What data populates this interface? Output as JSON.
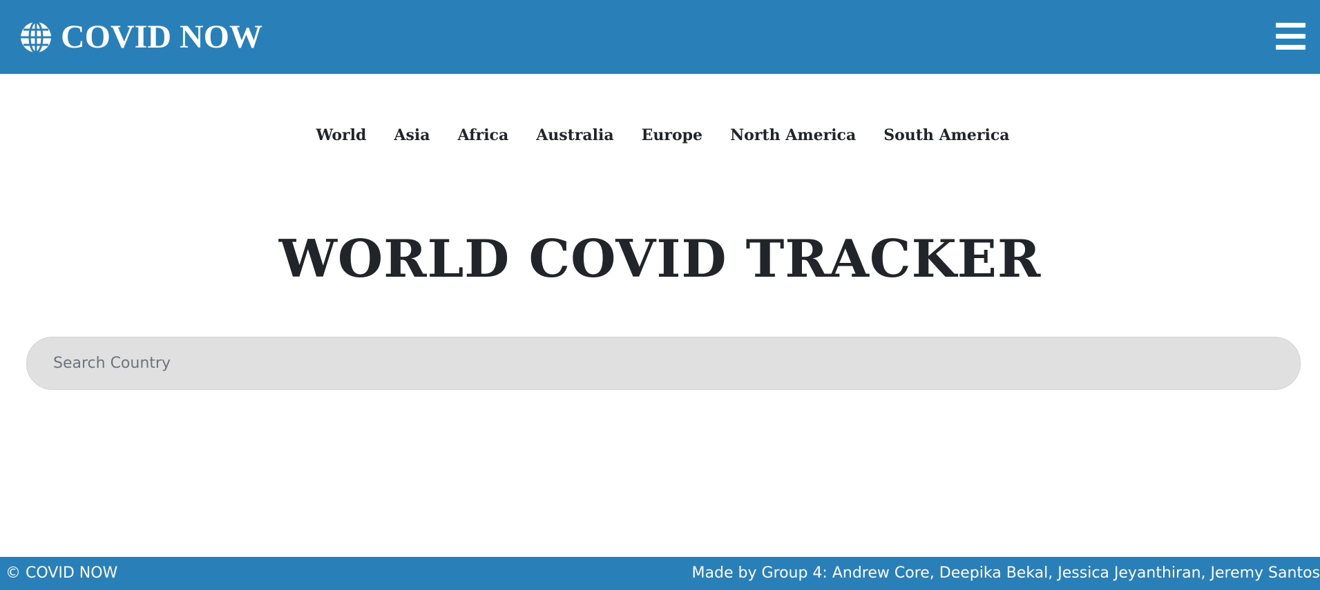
{
  "header": {
    "brand_title": "COVID NOW",
    "brand_icon": "globe-icon",
    "menu_icon": "hamburger-menu-icon",
    "background_color": "#2980b9"
  },
  "nav": {
    "items": [
      {
        "label": "World"
      },
      {
        "label": "Asia"
      },
      {
        "label": "Africa"
      },
      {
        "label": "Australia"
      },
      {
        "label": "Europe"
      },
      {
        "label": "North America"
      },
      {
        "label": "South America"
      }
    ]
  },
  "main": {
    "title": "WORLD COVID TRACKER",
    "search": {
      "placeholder": "Search Country",
      "value": ""
    }
  },
  "footer": {
    "copyright": "© COVID NOW",
    "credits": "Made by Group 4: Andrew Core, Deepika Bekal, Jessica Jeyanthiran, Jeremy Santos"
  }
}
